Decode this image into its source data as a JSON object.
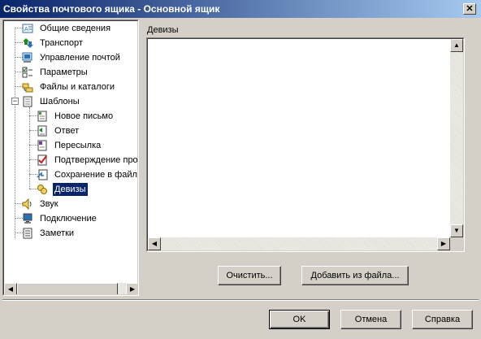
{
  "window": {
    "title": "Свойства почтового ящика - Основной ящик",
    "close_glyph": "✕"
  },
  "tree": {
    "items": [
      {
        "label": "Общие сведения",
        "icon": "info-card-icon",
        "color": "#2b6fb5"
      },
      {
        "label": "Транспорт",
        "icon": "transport-arrows-icon",
        "color": "#1a8a1a"
      },
      {
        "label": "Управление почтой",
        "icon": "mail-management-icon",
        "color": "#2b6fb5"
      },
      {
        "label": "Параметры",
        "icon": "checklist-icon",
        "color": "#1a8a1a"
      },
      {
        "label": "Файлы и каталоги",
        "icon": "folders-icon",
        "color": "#d6b100"
      },
      {
        "label": "Шаблоны",
        "icon": "templates-document-icon",
        "color": "#808080"
      },
      {
        "label": "Новое письмо",
        "icon": "new-letter-icon",
        "color": "#3a9a3a"
      },
      {
        "label": "Ответ",
        "icon": "reply-icon",
        "color": "#1a8a1a"
      },
      {
        "label": "Пересылка",
        "icon": "forward-icon",
        "color": "#7a3aa6"
      },
      {
        "label": "Подтверждение про",
        "icon": "confirmation-icon",
        "color": "#c02020"
      },
      {
        "label": "Сохранение в файл",
        "icon": "save-to-file-icon",
        "color": "#2b6fb5"
      },
      {
        "label": "Девизы",
        "icon": "mottos-icon",
        "color": "#d6b100"
      },
      {
        "label": "Звук",
        "icon": "speaker-icon",
        "color": "#d6b100"
      },
      {
        "label": "Подключение",
        "icon": "computer-connection-icon",
        "color": "#2b6fb5"
      },
      {
        "label": "Заметки",
        "icon": "notes-icon",
        "color": "#808080"
      }
    ],
    "expander_glyph": "−",
    "scroll_left_glyph": "◀",
    "scroll_right_glyph": "▶"
  },
  "panel": {
    "mottos_label": "Девизы",
    "text_value": "",
    "scroll_up_glyph": "▲",
    "scroll_down_glyph": "▼",
    "scroll_left_glyph": "◀",
    "scroll_right_glyph": "▶",
    "clear_button": "Очистить...",
    "add_from_file_button": "Добавить из файла..."
  },
  "footer": {
    "ok": "OK",
    "cancel": "Отмена",
    "help": "Справка"
  },
  "colors": {
    "title_start": "#0a246a",
    "title_end": "#a6caf0",
    "selection": "#0a246a",
    "face": "#d4d0c8"
  }
}
